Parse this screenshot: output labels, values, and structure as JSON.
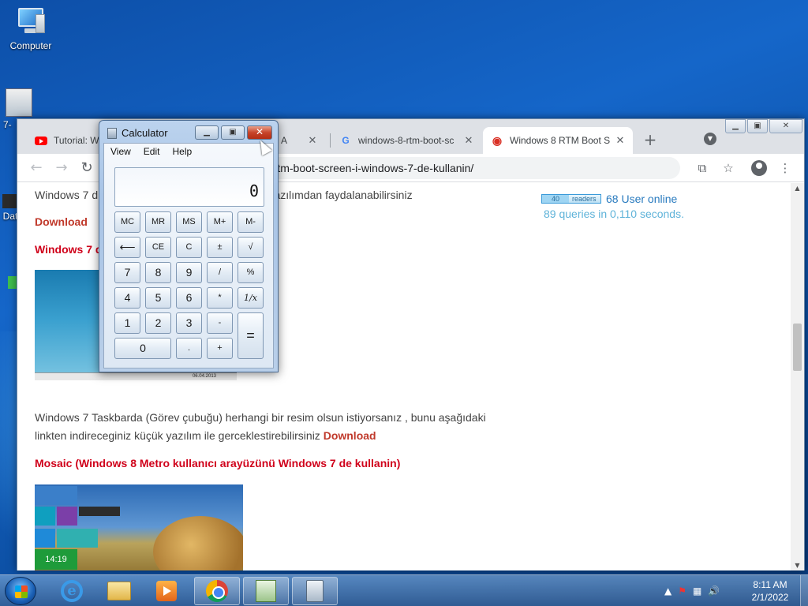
{
  "desktop": {
    "icons": [
      {
        "label": "Computer"
      },
      {
        "label": "7-"
      },
      {
        "label": "Dat"
      }
    ]
  },
  "chrome": {
    "tabs": [
      {
        "title": "Tutorial: W",
        "favicon": "youtube-icon"
      },
      {
        "title": "A",
        "favicon": "page-icon"
      },
      {
        "title": "windows-8-rtm-boot-sc",
        "favicon": "google-icon"
      },
      {
        "title": "Windows 8 RTM Boot S",
        "favicon": "site-icon"
      }
    ],
    "new_tab": "+",
    "address": "-rtm-boot-screen-i-windows-7-de-kullanin/"
  },
  "page": {
    "intro_text": "Windows 7 d",
    "intro_text_rest": "re yazılımdan faydalanabilirsiniz",
    "download_1": "Download",
    "heading_1": "Windows 7 d",
    "readers_count": "40",
    "readers_label": "readers",
    "online": "68 User online",
    "queries": "89 queries in 0,110 seconds.",
    "image1_date": "06.04.2013",
    "para_line1": "Windows 7 Taskbarda (Görev çubuğu) herhangi bir resim olsun istiyorsanız , bunu aşağıdaki",
    "para_line2": "linkten indireceginiz küçük yazılım ile gerceklestirebilirsiniz",
    "download_2": "Download",
    "heading_2": "Mosaic (Windows 8 Metro kullanıcı arayüzünü Windows 7 de kullanin)",
    "tile_time": "14:19"
  },
  "calculator": {
    "title": "Calculator",
    "menu": [
      "View",
      "Edit",
      "Help"
    ],
    "display": "0",
    "keys": {
      "mc": "MC",
      "mr": "MR",
      "ms": "MS",
      "mplus": "M+",
      "mminus": "M-",
      "back": "⟵",
      "ce": "CE",
      "c": "C",
      "plusminus": "±",
      "sqrt": "√",
      "k7": "7",
      "k8": "8",
      "k9": "9",
      "div": "/",
      "pct": "%",
      "k4": "4",
      "k5": "5",
      "k6": "6",
      "mul": "*",
      "recip": "1/x",
      "k1": "1",
      "k2": "2",
      "k3": "3",
      "sub": "-",
      "eq": "=",
      "k0": "0",
      "dot": ".",
      "add": "+"
    }
  },
  "taskbar": {
    "time": "8:11 AM",
    "date": "2/1/2022"
  }
}
